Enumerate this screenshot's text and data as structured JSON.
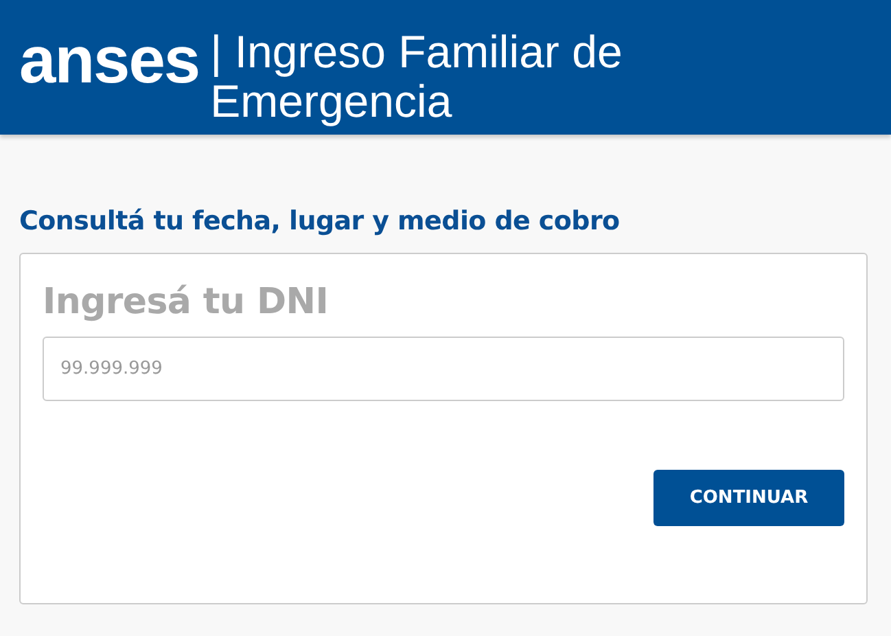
{
  "header": {
    "logo": "anses",
    "title": "| Ingreso Familiar de Emergencia"
  },
  "heading": "Consultá tu fecha, lugar y medio de cobro",
  "card": {
    "title": "Ingresá tu DNI",
    "dni_field": {
      "placeholder": "99.999.999"
    },
    "button": "CONTINUAR"
  }
}
